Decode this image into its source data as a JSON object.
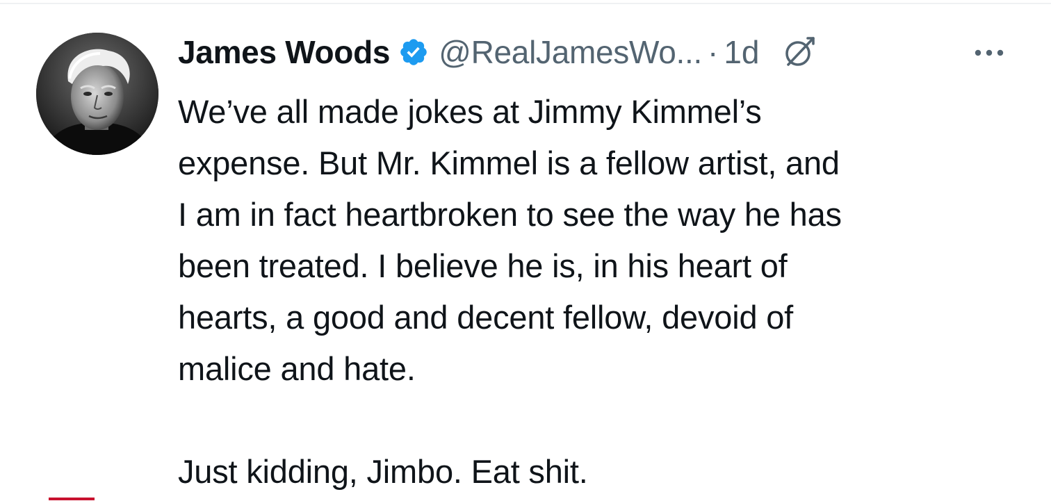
{
  "tweet": {
    "author": {
      "display_name": "James Woods",
      "handle": "@RealJamesWo...",
      "verified": true,
      "avatar_icon": "profile-photo"
    },
    "separator": "·",
    "time": "1d",
    "grok_icon": "grok-icon",
    "more_icon": "more-options-icon",
    "text_lines": [
      "We’ve all made jokes at Jimmy Kimmel’s",
      "expense. But Mr. Kimmel is a fellow artist, and",
      "I am in fact heartbroken to see the way he has",
      "been treated. I believe he is, in his heart of",
      "hearts, a good and decent fellow, devoid of",
      "malice and hate."
    ],
    "closing_line": "Just kidding, Jimbo. Eat shit."
  },
  "colors": {
    "text": "#0f1419",
    "secondary": "#536471",
    "verified_blue": "#1d9bf0",
    "accent_red": "#c8102e"
  }
}
